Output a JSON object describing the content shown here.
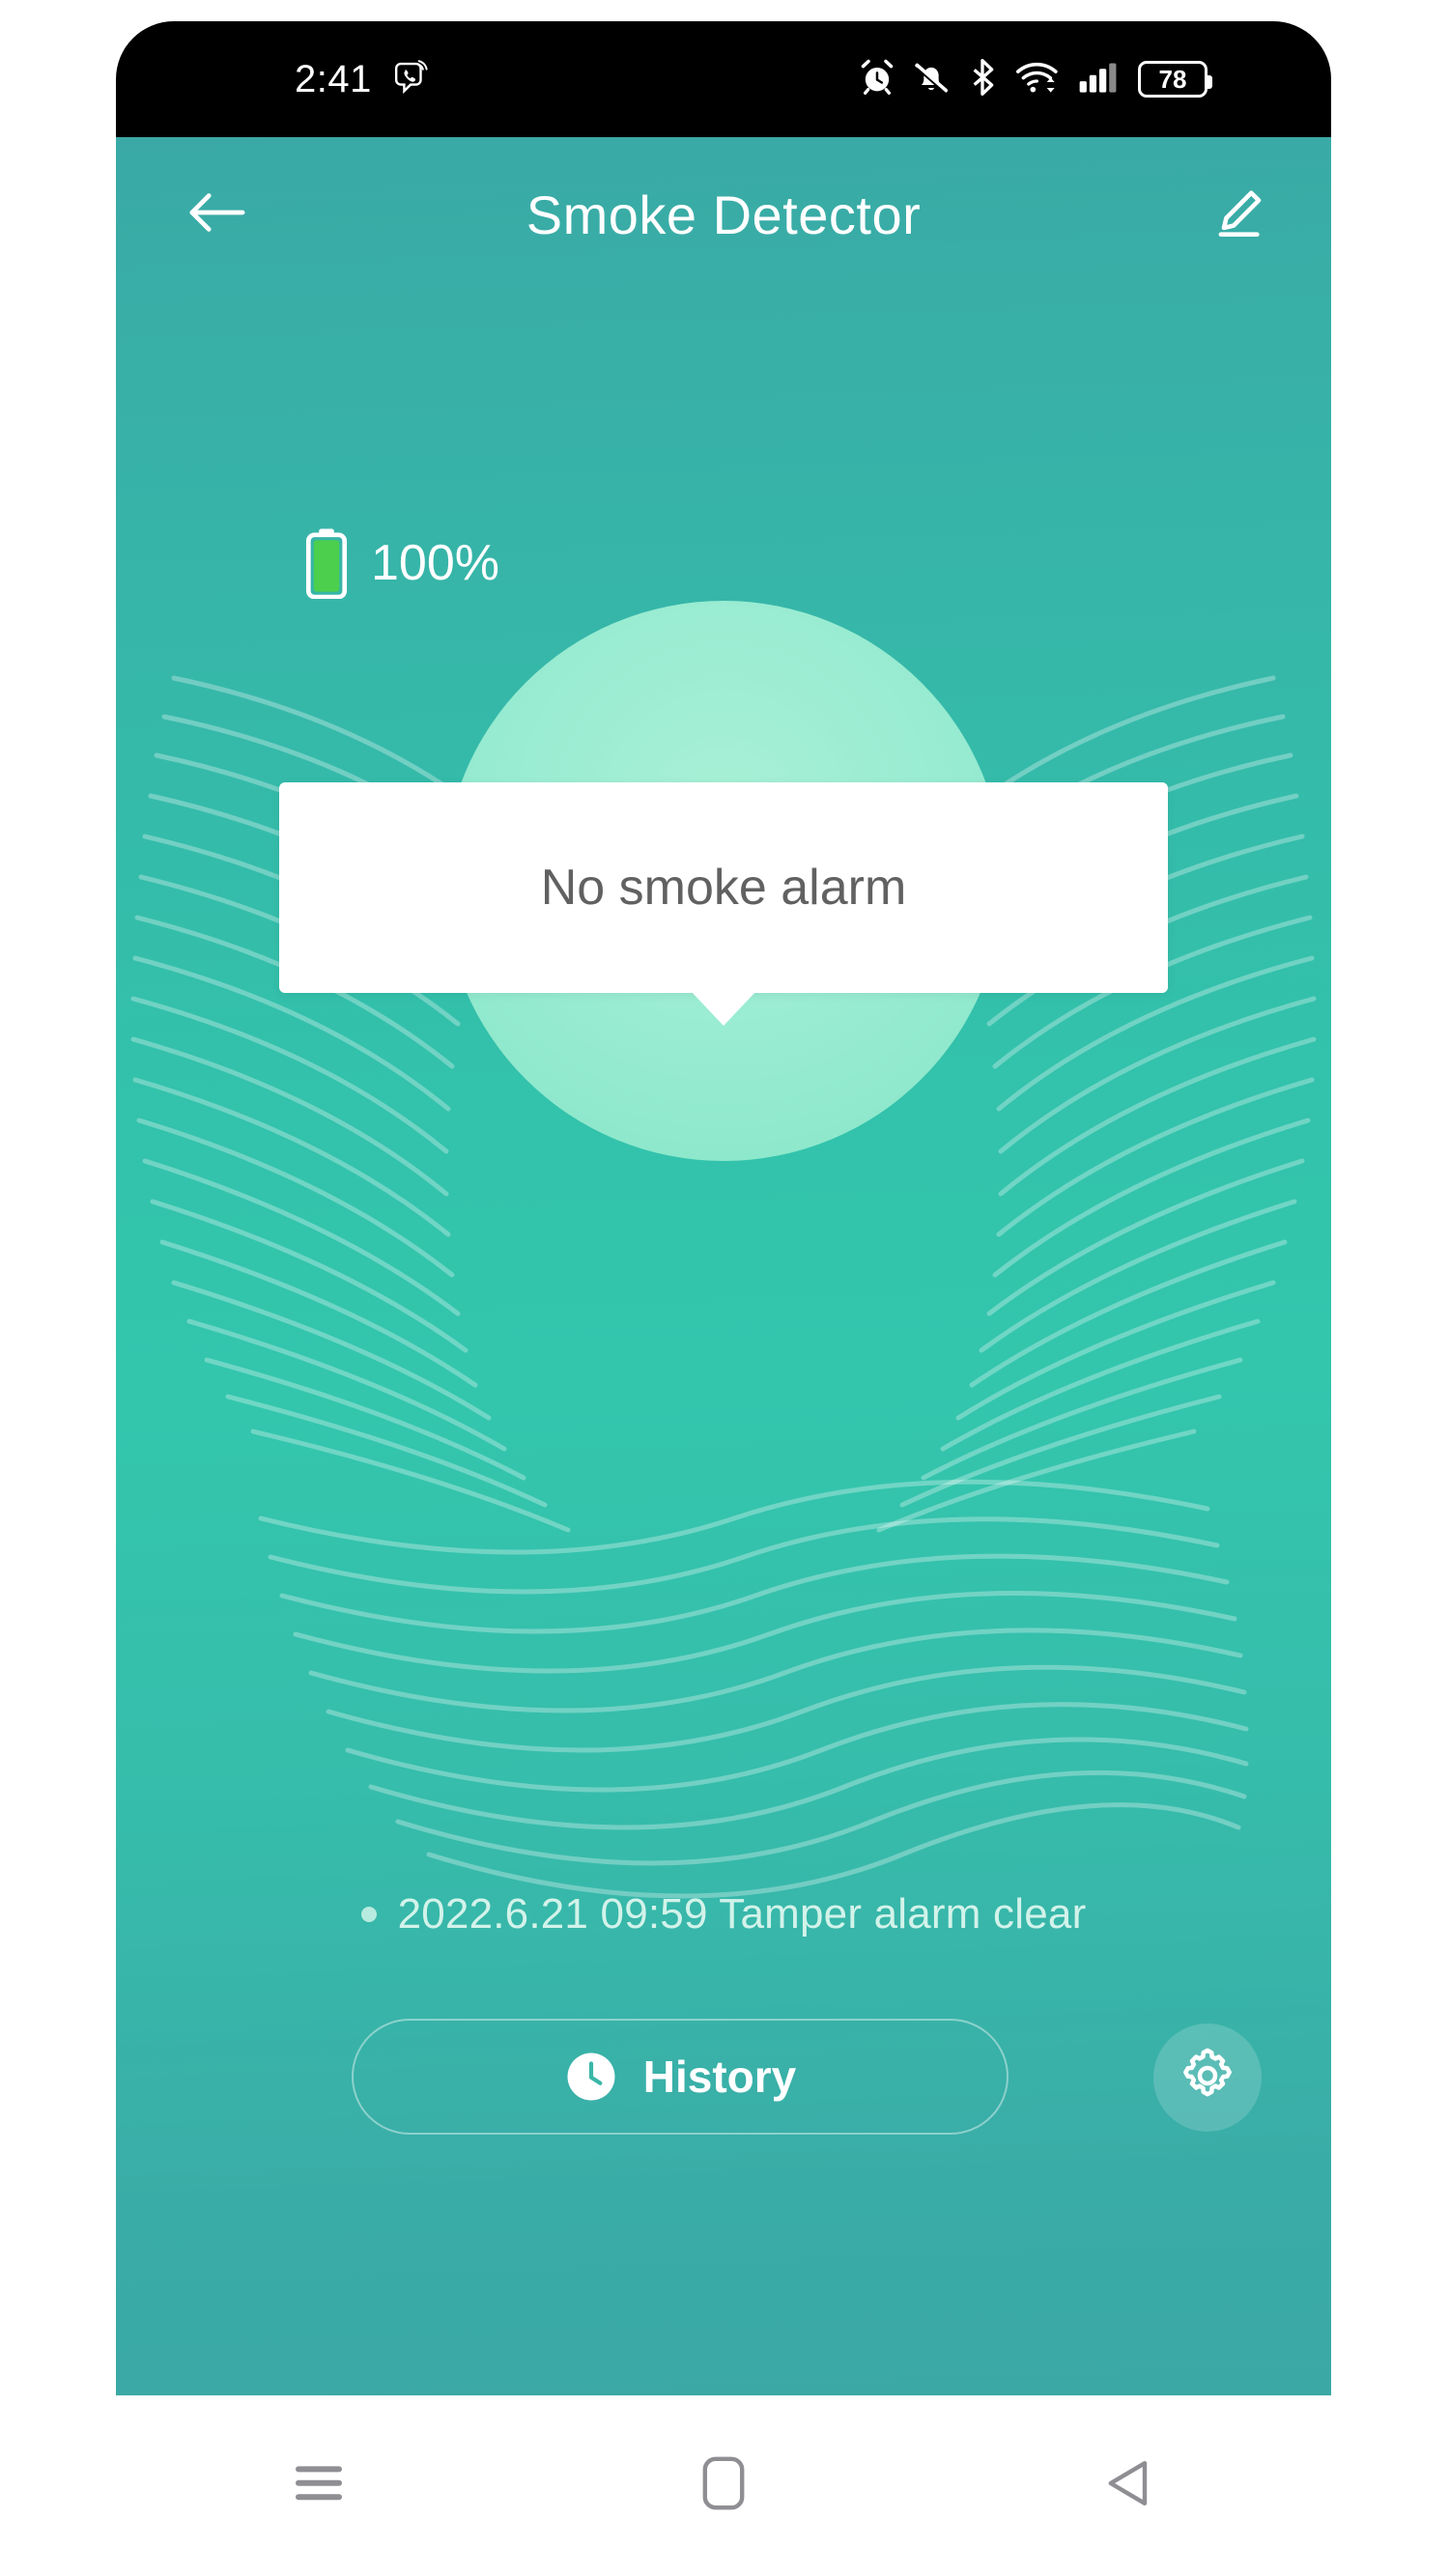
{
  "status_bar": {
    "time": "2:41",
    "left_icons": [
      "viber-call-icon"
    ],
    "right_icons": [
      "alarm-clock-icon",
      "bell-muted-icon",
      "bluetooth-icon",
      "wifi-icon",
      "cellular-signal-icon"
    ],
    "battery_level": "78"
  },
  "app_bar": {
    "back_icon": "arrow-left-icon",
    "title": "Smoke Detector",
    "edit_icon": "pencil-edit-icon"
  },
  "device": {
    "battery_icon": "battery-vertical-icon",
    "battery_percent": "100%",
    "status_tooltip": "No smoke alarm",
    "device_icon": "smoke-waves-icon"
  },
  "log": {
    "bullet": "•",
    "entry": "2022.6.21 09:59 Tamper alarm clear"
  },
  "actions": {
    "history_icon": "clock-icon",
    "history_label": "History",
    "settings_icon": "gear-icon"
  },
  "android_nav": {
    "recents_icon": "menu-lines-icon",
    "home_icon": "home-square-icon",
    "back_icon": "back-triangle-icon"
  },
  "colors": {
    "teal_top": "#3aa9a6",
    "teal_mid": "#33c6ad",
    "teal_bottom": "#3ba8a5",
    "circle_mint": "#9aecd2",
    "smoke_gold": "#e2c46a",
    "battery_green": "#4ccf4c",
    "tooltip_bg": "#ffffff",
    "tooltip_text": "#616161"
  }
}
